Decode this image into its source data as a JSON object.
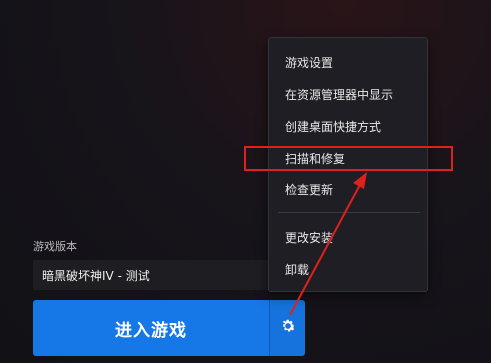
{
  "version": {
    "label": "游戏版本",
    "selected": "暗黑破坏神IV - 测试"
  },
  "play_button": {
    "label": "进入游戏"
  },
  "menu": {
    "items": [
      {
        "label": "游戏设置"
      },
      {
        "label": "在资源管理器中显示"
      },
      {
        "label": "创建桌面快捷方式"
      },
      {
        "label": "扫描和修复"
      },
      {
        "label": "检查更新"
      },
      {
        "label": "更改安装"
      },
      {
        "label": "卸载"
      }
    ]
  },
  "annotation": {
    "color": "#e0201c",
    "icon": "red-arrow"
  },
  "colors": {
    "accent": "#1578e6"
  },
  "icons": {
    "settings": "gear-icon"
  }
}
